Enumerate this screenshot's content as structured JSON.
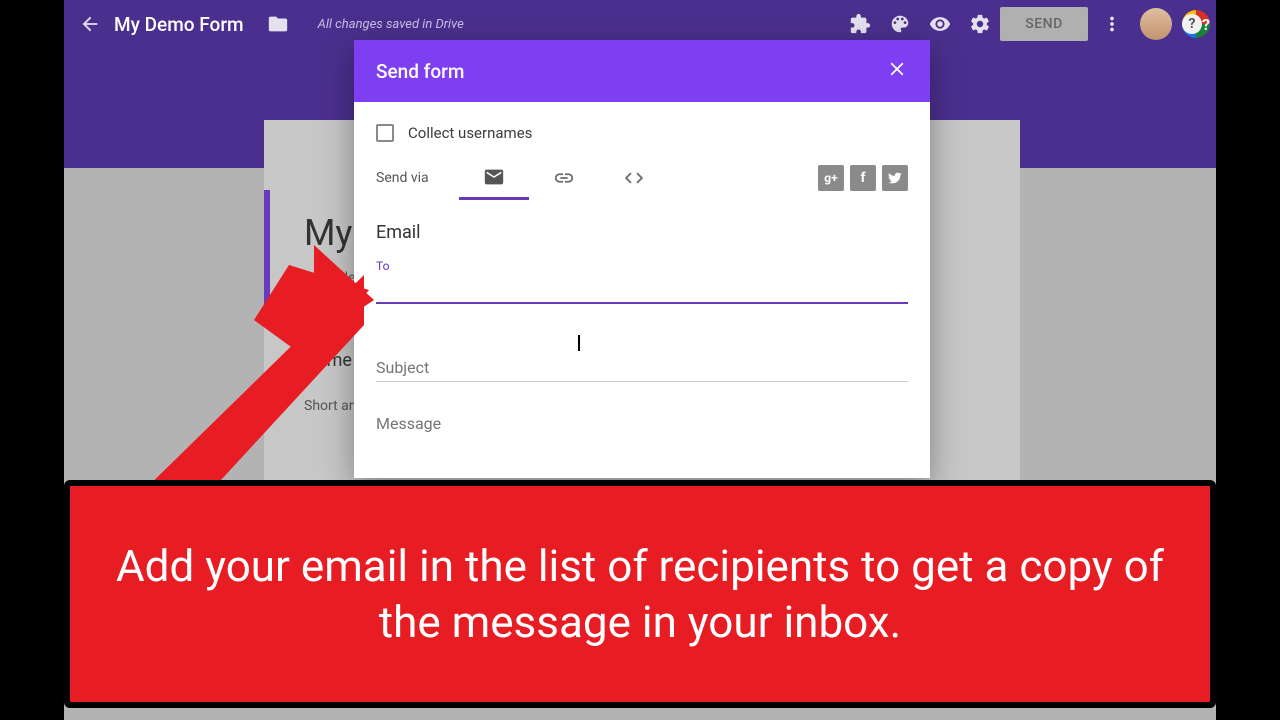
{
  "header": {
    "form_name": "My Demo Form",
    "save_status": "All changes saved in Drive",
    "send_button": "SEND"
  },
  "background_form": {
    "title_partial": "My",
    "description_partial": "Form de",
    "question_partial": "Name",
    "answer_partial": "Short an"
  },
  "dialog": {
    "title": "Send form",
    "collect_usernames": "Collect usernames",
    "send_via_label": "Send via",
    "section_heading": "Email",
    "to_label": "To",
    "to_value": "",
    "subject_placeholder": "Subject",
    "message_placeholder": "Message",
    "share": {
      "gplus": "g+",
      "facebook": "f",
      "twitter": "t"
    }
  },
  "banner_text": "Add your email in the list of recipients to get a copy of the message in your inbox."
}
